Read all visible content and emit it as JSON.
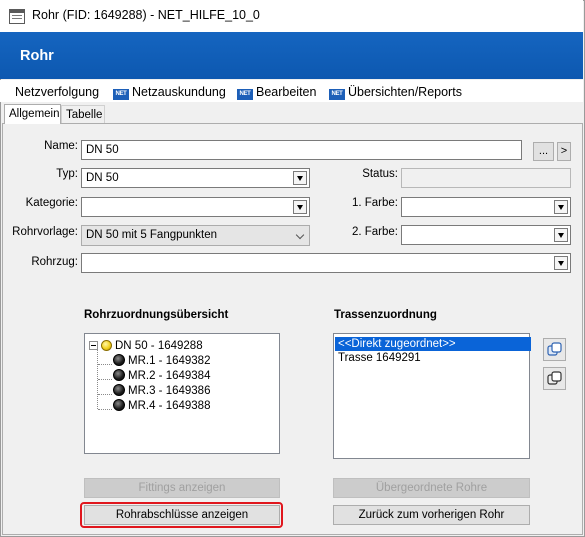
{
  "window": {
    "title": "Rohr (FID: 1649288) - NET_HILFE_10_0"
  },
  "banner": {
    "title": "Rohr"
  },
  "menu": {
    "items": [
      {
        "label": "Netzverfolgung",
        "icon": ""
      },
      {
        "label": "Netzauskundung",
        "icon": "net-icon"
      },
      {
        "label": "Bearbeiten",
        "icon": "net-icon"
      },
      {
        "label": "Übersichten/Reports",
        "icon": "net-icon"
      }
    ],
    "icon_text": "NET"
  },
  "tabs": [
    {
      "label": "Allgemein",
      "active": true
    },
    {
      "label": "Tabelle",
      "active": false
    }
  ],
  "form": {
    "name": {
      "label": "Name:",
      "value": "DN 50",
      "dots_button": "...",
      "next_button": ">"
    },
    "typ": {
      "label": "Typ:",
      "value": "DN 50"
    },
    "status": {
      "label": "Status:",
      "value": ""
    },
    "kategorie": {
      "label": "Kategorie:",
      "value": ""
    },
    "farbe1": {
      "label": "1. Farbe:",
      "value": ""
    },
    "rohrvorlage": {
      "label": "Rohrvorlage:",
      "value": "DN 50 mit 5 Fangpunkten"
    },
    "farbe2": {
      "label": "2. Farbe:",
      "value": ""
    },
    "rohrzug": {
      "label": "Rohrzug:",
      "value": ""
    }
  },
  "rohrzuordnung": {
    "title": "Rohrzuordnungsübersicht",
    "root": {
      "label": "DN 50 - 1649288",
      "icon": "yellow-bulb-icon"
    },
    "children": [
      {
        "label": "MR.1 - 1649382",
        "icon": "black-disk-icon"
      },
      {
        "label": "MR.2 - 1649384",
        "icon": "black-disk-icon"
      },
      {
        "label": "MR.3 - 1649386",
        "icon": "black-disk-icon"
      },
      {
        "label": "MR.4 - 1649388",
        "icon": "black-disk-icon"
      }
    ]
  },
  "trassenzuordnung": {
    "title": "Trassenzuordnung",
    "items": [
      {
        "label": "<<Direkt zugeordnet>>",
        "selected": true
      },
      {
        "label": "Trasse 1649291",
        "selected": false
      }
    ]
  },
  "buttons": {
    "fittings": "Fittings anzeigen",
    "uebergeordnete": "Übergeordnete Rohre",
    "rohrabschluesse": "Rohrabschlüsse anzeigen",
    "zurueck": "Zurück zum vorherigen Rohr"
  },
  "colors": {
    "banner": "#1565c0",
    "selection": "#0a64d8",
    "highlight": "#e0161d"
  }
}
